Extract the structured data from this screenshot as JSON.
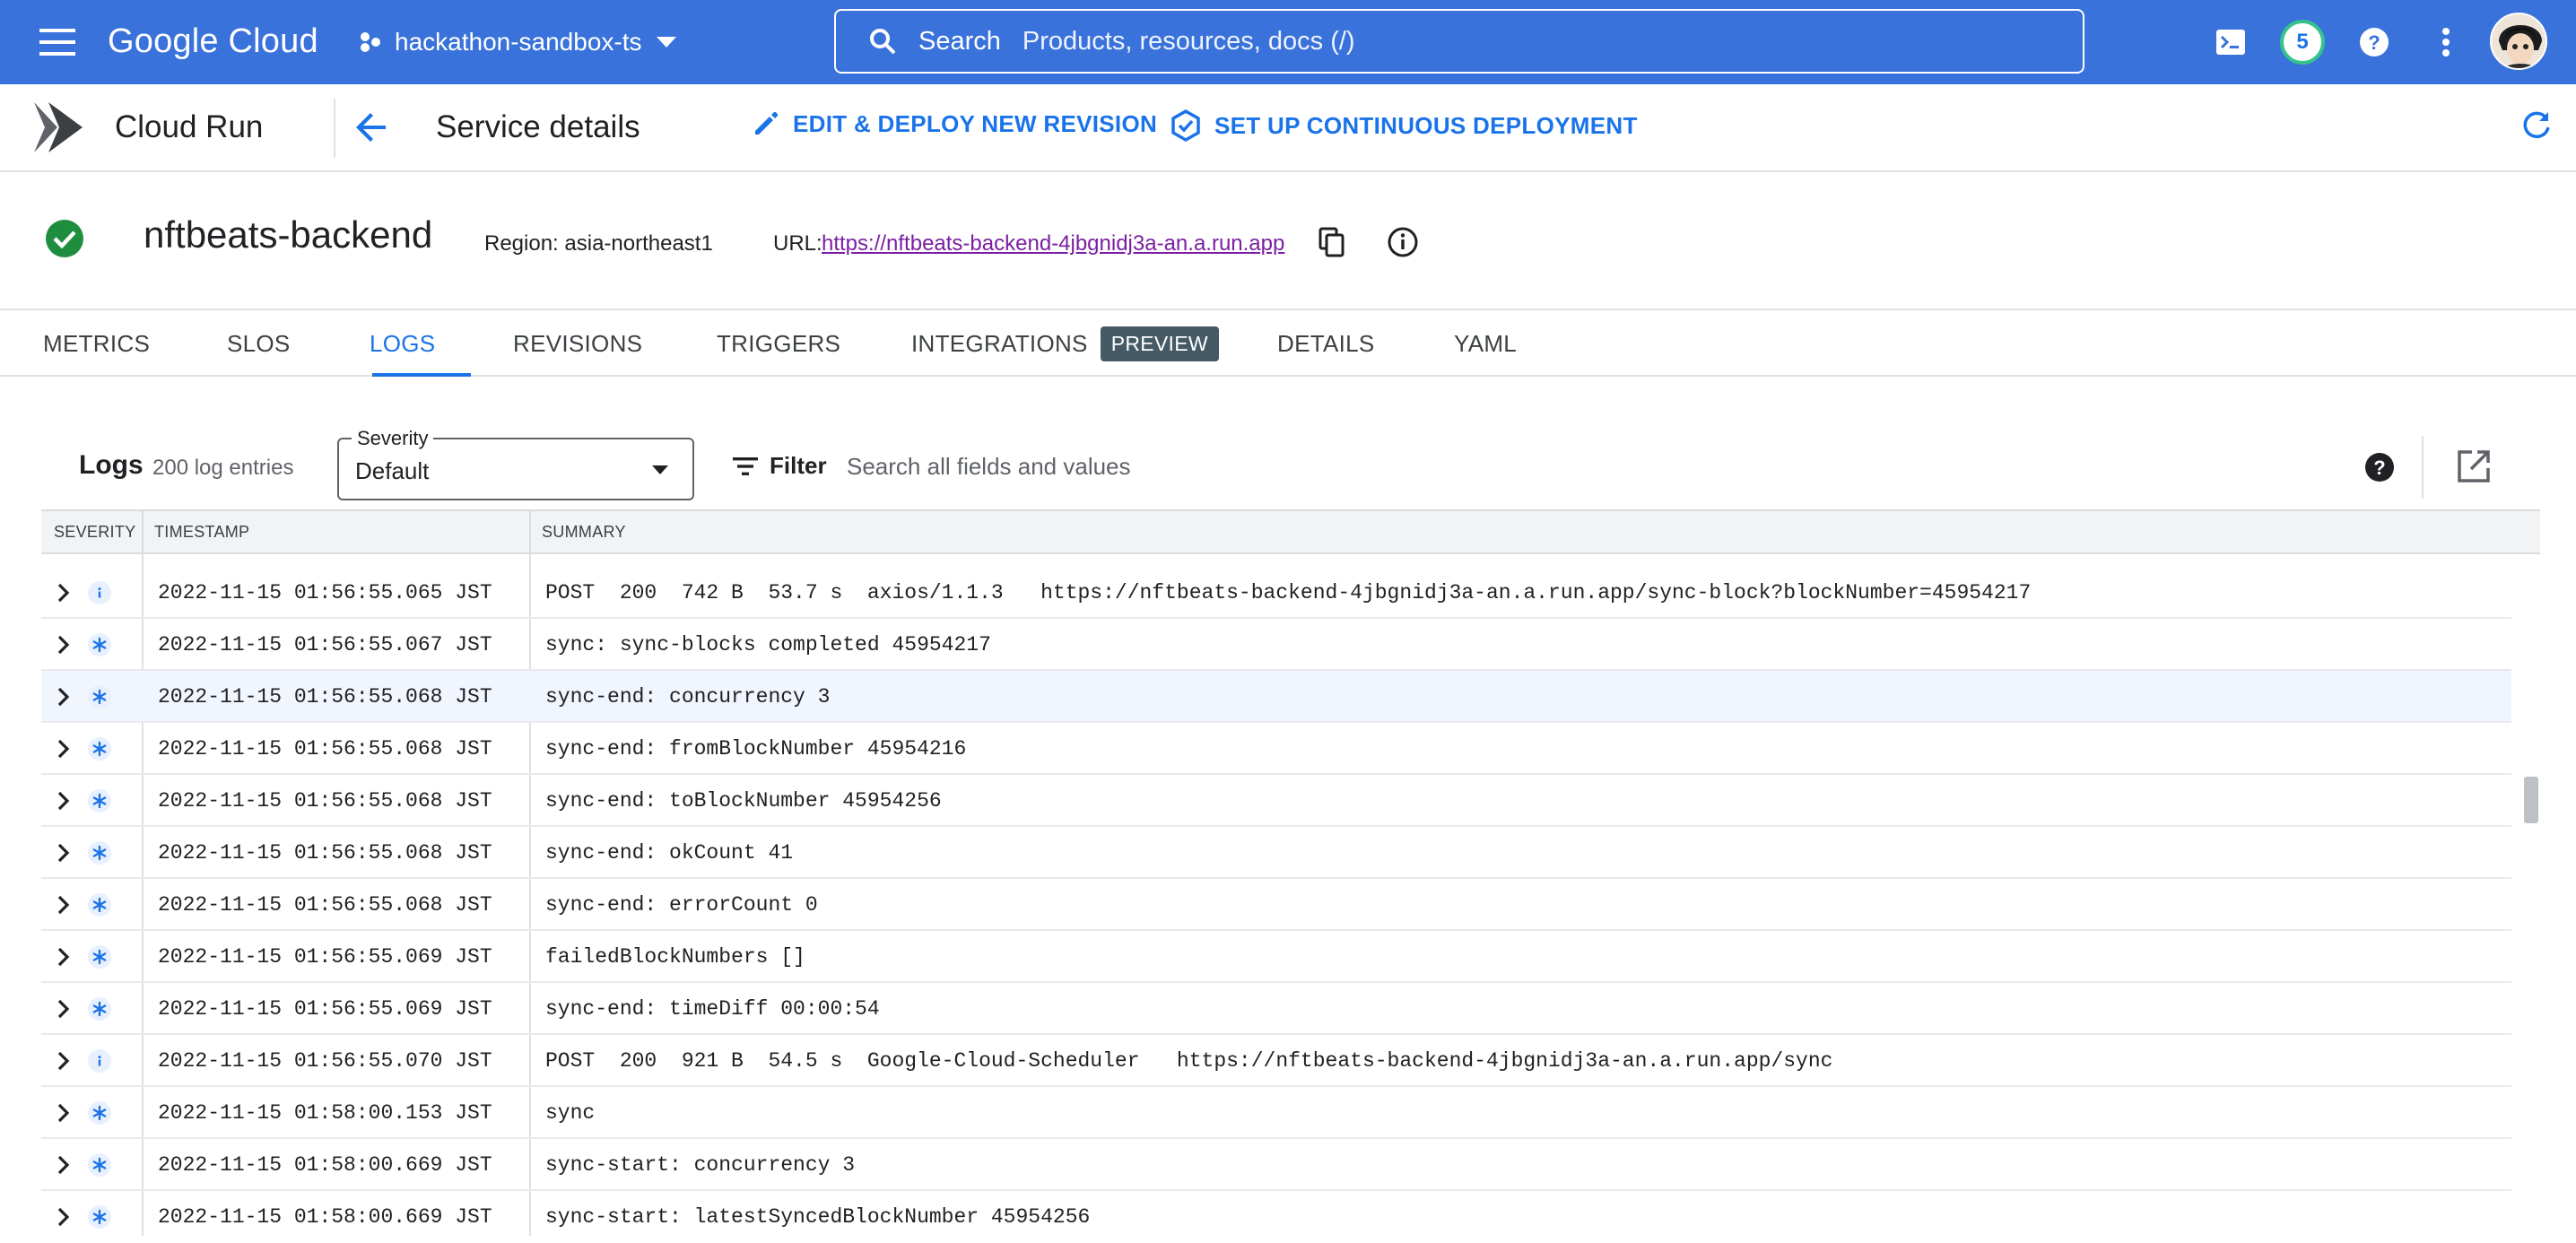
{
  "topbar": {
    "logo": "Google Cloud",
    "project": "hackathon-sandbox-ts",
    "search_label": "Search",
    "search_placeholder": "Products, resources, docs (/)",
    "notifications_count": "5"
  },
  "product": {
    "title": "Cloud Run",
    "page_title": "Service details",
    "edit_deploy_label": "EDIT & DEPLOY NEW REVISION",
    "continuous_deploy_label": "SET UP CONTINUOUS DEPLOYMENT"
  },
  "service": {
    "name": "nftbeats-backend",
    "region": "Region: asia-northeast1",
    "url_label": "URL:",
    "url": "https://nftbeats-backend-4jbgnidj3a-an.a.run.app"
  },
  "tabs": [
    {
      "label": "METRICS"
    },
    {
      "label": "SLOS"
    },
    {
      "label": "LOGS"
    },
    {
      "label": "REVISIONS"
    },
    {
      "label": "TRIGGERS"
    },
    {
      "label": "INTEGRATIONS",
      "chip": "PREVIEW"
    },
    {
      "label": "DETAILS"
    },
    {
      "label": "YAML"
    }
  ],
  "active_tab": "LOGS",
  "logs": {
    "title": "Logs",
    "count": "200 log entries",
    "severity_label": "Severity",
    "severity_value": "Default",
    "filter_label": "Filter",
    "filter_placeholder": "Search all fields and values",
    "columns": [
      "SEVERITY",
      "TIMESTAMP",
      "SUMMARY"
    ],
    "rows": [
      {
        "severity": "info",
        "timestamp": "2022-11-15 01:56:55.065 JST",
        "summary": "POST  200  742 B  53.7 s  axios/1.1.3   https://nftbeats-backend-4jbgnidj3a-an.a.run.app/sync-block?blockNumber=45954217"
      },
      {
        "severity": "default",
        "timestamp": "2022-11-15 01:56:55.067 JST",
        "summary": "sync: sync-blocks completed 45954217"
      },
      {
        "severity": "default",
        "timestamp": "2022-11-15 01:56:55.068 JST",
        "summary": "sync-end: concurrency 3"
      },
      {
        "severity": "default",
        "timestamp": "2022-11-15 01:56:55.068 JST",
        "summary": "sync-end: fromBlockNumber 45954216"
      },
      {
        "severity": "default",
        "timestamp": "2022-11-15 01:56:55.068 JST",
        "summary": "sync-end: toBlockNumber 45954256"
      },
      {
        "severity": "default",
        "timestamp": "2022-11-15 01:56:55.068 JST",
        "summary": "sync-end: okCount 41"
      },
      {
        "severity": "default",
        "timestamp": "2022-11-15 01:56:55.068 JST",
        "summary": "sync-end: errorCount 0"
      },
      {
        "severity": "default",
        "timestamp": "2022-11-15 01:56:55.069 JST",
        "summary": "failedBlockNumbers []"
      },
      {
        "severity": "default",
        "timestamp": "2022-11-15 01:56:55.069 JST",
        "summary": "sync-end: timeDiff 00:00:54"
      },
      {
        "severity": "info",
        "timestamp": "2022-11-15 01:56:55.070 JST",
        "summary": "POST  200  921 B  54.5 s  Google-Cloud-Scheduler   https://nftbeats-backend-4jbgnidj3a-an.a.run.app/sync"
      },
      {
        "severity": "default",
        "timestamp": "2022-11-15 01:58:00.153 JST",
        "summary": "sync"
      },
      {
        "severity": "default",
        "timestamp": "2022-11-15 01:58:00.669 JST",
        "summary": "sync-start: concurrency 3"
      },
      {
        "severity": "default",
        "timestamp": "2022-11-15 01:58:00.669 JST",
        "summary": "sync-start: latestSyncedBlockNumber 45954256"
      }
    ],
    "highlighted_row": 2
  },
  "colors": {
    "topbar": "#3a72db",
    "accent": "#1a73e8",
    "success": "#1e8e3e",
    "link_visited": "#7b1fa2",
    "chip": "#455a64"
  },
  "icons": {
    "menu": "menu-icon",
    "project": "project-icon",
    "search": "search-icon",
    "cloud_shell": "terminal-icon",
    "help": "help-icon",
    "more": "more-vert-icon",
    "cloud_run": "cloud-run-logo-icon",
    "back": "arrow-back-icon",
    "edit": "pencil-icon",
    "deploy": "continuous-deploy-icon",
    "refresh": "refresh-icon",
    "status": "check-circle-icon",
    "copy": "copy-icon",
    "info": "info-icon",
    "filter": "filter-list-icon",
    "open": "open-in-new-icon"
  }
}
